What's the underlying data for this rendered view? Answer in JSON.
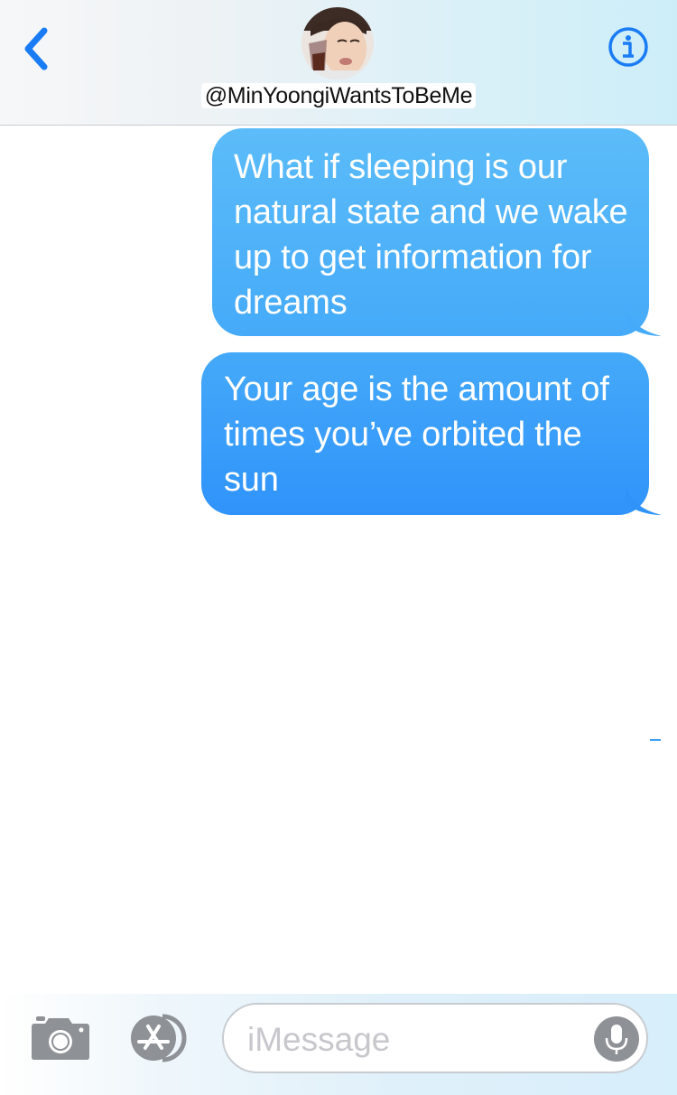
{
  "header": {
    "contact_name": "@MinYoongiWantsToBeMe",
    "back_icon": "chevron-left-icon",
    "info_icon": "info-circle-icon",
    "accent_color": "#1a7cf5"
  },
  "messages": [
    {
      "sender": "me",
      "text": "What if sleeping is our natural state and we wake up to get information for dreams"
    },
    {
      "sender": "me",
      "text": "Your age is the amount of times you’ve orbited the sun"
    }
  ],
  "input_bar": {
    "placeholder": "iMessage",
    "camera_icon": "camera-icon",
    "appstore_icon": "app-store-icon",
    "mic_icon": "microphone-icon"
  },
  "colors": {
    "bubble_top": "#56b6f9",
    "bubble_bottom": "#3196fa",
    "placeholder": "#c7c7cc"
  }
}
